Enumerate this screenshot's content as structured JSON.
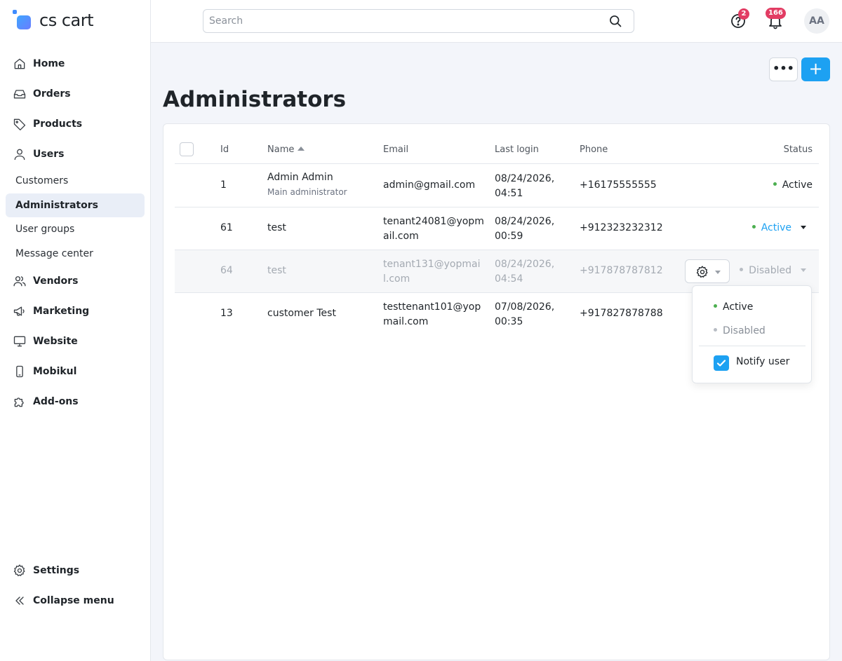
{
  "app": {
    "logo_text": "cs cart"
  },
  "topbar": {
    "search_placeholder": "Search",
    "help_badge": "2",
    "notifications_badge": "166",
    "avatar_initials": "AA"
  },
  "sidebar": {
    "items": [
      {
        "label": "Home",
        "icon": "home-icon"
      },
      {
        "label": "Orders",
        "icon": "inbox-icon"
      },
      {
        "label": "Products",
        "icon": "tag-icon"
      },
      {
        "label": "Users",
        "icon": "user-icon"
      }
    ],
    "users_sub": [
      {
        "label": "Customers"
      },
      {
        "label": "Administrators",
        "active": true
      },
      {
        "label": "User groups"
      },
      {
        "label": "Message center"
      }
    ],
    "items2": [
      {
        "label": "Vendors",
        "icon": "users-icon"
      },
      {
        "label": "Marketing",
        "icon": "megaphone-icon"
      },
      {
        "label": "Website",
        "icon": "monitor-icon"
      },
      {
        "label": "Mobikul",
        "icon": "phone-icon"
      },
      {
        "label": "Add-ons",
        "icon": "puzzle-icon"
      }
    ],
    "bottom": [
      {
        "label": "Settings",
        "icon": "gear-icon"
      },
      {
        "label": "Collapse menu",
        "icon": "chevrons-left-icon"
      }
    ]
  },
  "page": {
    "title": "Administrators",
    "more_label": "•••",
    "add_label": "+"
  },
  "table": {
    "headers": {
      "id": "Id",
      "name": "Name",
      "email": "Email",
      "last_login": "Last login",
      "phone": "Phone",
      "status": "Status"
    },
    "rows": [
      {
        "id": "1",
        "name": "Admin Admin",
        "role": "Main administrator",
        "email": [
          "admin@gmail.com"
        ],
        "login": [
          "08/24/2026,",
          "04:51"
        ],
        "phone": "+16175555555",
        "status": "Active"
      },
      {
        "id": "61",
        "name": "test",
        "email": [
          "tenant24081@yopm",
          "ail.com"
        ],
        "login": [
          "08/24/2026,",
          "00:59"
        ],
        "phone": "+912323232312",
        "status": "Active"
      },
      {
        "id": "64",
        "name": "test",
        "email": [
          "tenant131@yopmai",
          "l.com"
        ],
        "login": [
          "08/24/2026,",
          "04:54"
        ],
        "phone": "+917878787812",
        "status": "Disabled"
      },
      {
        "id": "13",
        "name": "customer Test",
        "email": [
          "testtenant101@yop",
          "mail.com"
        ],
        "login": [
          "07/08/2026,",
          "00:35"
        ],
        "phone": "+917827878788",
        "status": ""
      }
    ]
  },
  "status_dropdown": {
    "options": [
      "Active",
      "Disabled"
    ],
    "notify_label": "Notify user",
    "notify_checked": true
  },
  "colors": {
    "accent": "#1da1f2",
    "active_dot": "#4caf50",
    "badge": "#e23c63"
  }
}
